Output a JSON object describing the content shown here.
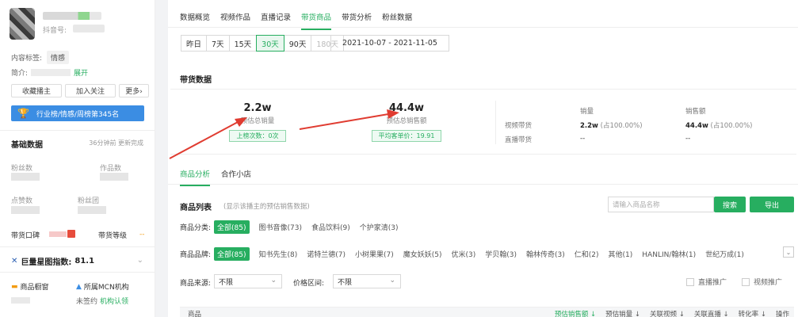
{
  "profile": {
    "douyin_label": "抖音号:",
    "content_tag_label": "内容标签:",
    "content_tag": "情感",
    "intro_label": "简介:",
    "intro_expand": "展开",
    "buttons": [
      "收藏播主",
      "加入关注",
      "更多›"
    ],
    "rank_button": "行业榜/情感/周榜第345名"
  },
  "basic": {
    "title": "基础数据",
    "update_note": "36分钟前  更新完成",
    "fans_label": "粉丝数",
    "works_label": "作品数",
    "likes_label": "点赞数",
    "fans_group_label": "粉丝团",
    "goods_label": "带货口碑",
    "goods_level_label": "带货等级",
    "goods_level_value": "--"
  },
  "xingtu": {
    "label": "巨量星图指数:",
    "value": "81.1"
  },
  "store": {
    "shop_label": "商品橱窗",
    "mcn_label": "所属MCN机构",
    "mcn_status": "未签约",
    "mcn_link": "机构认领"
  },
  "top_tabs": [
    "数据概览",
    "视频作品",
    "直播记录",
    "带货商品",
    "带货分析",
    "粉丝数据"
  ],
  "top_tabs_active": 3,
  "day_buttons": [
    "昨日",
    "7天",
    "15天",
    "30天",
    "90天",
    "180天"
  ],
  "day_active": 3,
  "date_range": "2021-10-07  -  2021-11-05",
  "sales_section": {
    "title": "带货数据",
    "kpi1": {
      "value": "2.2w",
      "label": "预估总销量",
      "chip": "上榜次数：0次"
    },
    "kpi2": {
      "value": "44.4w",
      "label": "预估总销售额",
      "chip": "平均客单价：19.91"
    },
    "table": {
      "col_sales": "销量",
      "col_amount": "销售额",
      "row1_label": "视频带货",
      "row1_sales": "2.2w",
      "row1_sales_pct": "(占100.00%)",
      "row1_amount": "44.4w",
      "row1_amount_pct": "(占100.00%)",
      "row2_label": "直播带货",
      "row2_sales": "--",
      "row2_amount": "--"
    }
  },
  "sub_tabs": [
    "商品分析",
    "合作小店"
  ],
  "product_list": {
    "title": "商品列表",
    "hint": "(显示该播主的预估销售数据)",
    "search_placeholder": "请输入商品名称",
    "search_button": "搜索",
    "export_button": "导出"
  },
  "category_filter": {
    "label": "商品分类:",
    "options": [
      "全部(85)",
      "图书音像(73)",
      "食品饮料(9)",
      "个护家清(3)"
    ]
  },
  "brand_filter": {
    "label": "商品品牌:",
    "options": [
      "全部(85)",
      "知书先生(8)",
      "诺特兰德(7)",
      "小树果果(7)",
      "魔女妖妖(5)",
      "优米(3)",
      "学贝翰(3)",
      "翰林传奇(3)",
      "仁和(2)",
      "其他(1)",
      "HANLIN/翰林(1)",
      "世纪万成(1)"
    ]
  },
  "source_filter": {
    "label": "商品来源:",
    "value": "不限"
  },
  "price_filter": {
    "label": "价格区间:",
    "value": "不限"
  },
  "checks": [
    "直播推广",
    "视频推广"
  ],
  "table_header": {
    "product": "商品",
    "cols": [
      "预估销售额 ↓",
      "预估销量 ↓",
      "关联视频 ↓",
      "关联直播 ↓",
      "转化率 ↓",
      "操作"
    ]
  },
  "colors": {
    "accent": "#27ae60",
    "blue": "#3b8de3",
    "arrow": "#e03c31"
  }
}
